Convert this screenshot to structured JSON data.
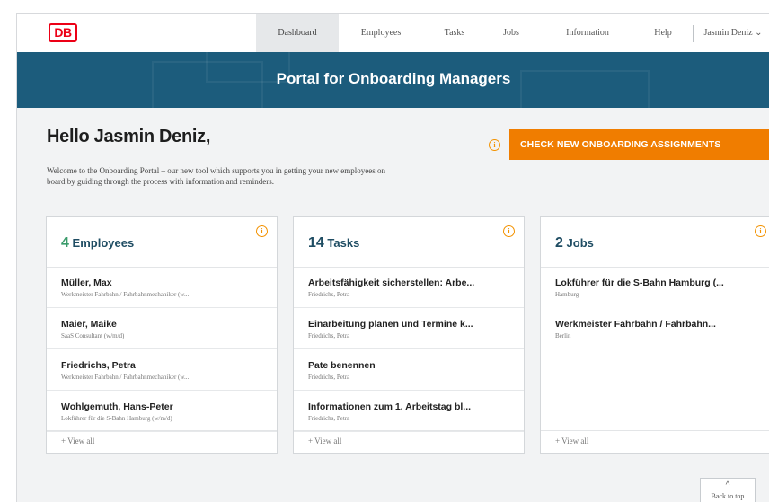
{
  "nav": {
    "logo": "DB",
    "items": [
      "Dashboard",
      "Employees",
      "Tasks",
      "Jobs",
      "Information",
      "Help"
    ],
    "user": "Jasmin Deniz ⌄"
  },
  "banner": {
    "title": "Portal for Onboarding Managers"
  },
  "greeting": "Hello Jasmin Deniz,",
  "intro": "Welcome to the Onboarding Portal – our new tool which supports you in getting your new employees on board by guiding through the process with information and reminders.",
  "cta": {
    "info": "i",
    "label": "CHECK NEW ONBOARDING ASSIGNMENTS"
  },
  "cards": [
    {
      "count": "4",
      "label": "Employees",
      "rows": [
        {
          "title": "Müller, Max",
          "sub": "Werkmeister Fahrbahn / Fahrbahnmechaniker (w..."
        },
        {
          "title": "Maier, Maike",
          "sub": "SaaS Consultant (w/m/d)"
        },
        {
          "title": "Friedrichs, Petra",
          "sub": "Werkmeister Fahrbahn / Fahrbahnmechaniker (w..."
        },
        {
          "title": "Wohlgemuth, Hans-Peter",
          "sub": "Lokführer für die S-Bahn Hamburg (w/m/d)"
        }
      ],
      "view_all": "+ View all"
    },
    {
      "count": "14",
      "label": "Tasks",
      "rows": [
        {
          "title": "Arbeitsfähigkeit sicherstellen: Arbe...",
          "sub": "Friedrichs, Petra"
        },
        {
          "title": "Einarbeitung planen und Termine k...",
          "sub": "Friedrichs, Petra"
        },
        {
          "title": "Pate benennen",
          "sub": "Friedrichs, Petra"
        },
        {
          "title": "Informationen zum 1. Arbeitstag bl...",
          "sub": "Friedrichs, Petra"
        }
      ],
      "view_all": "+ View all"
    },
    {
      "count": "2",
      "label": "Jobs",
      "rows": [
        {
          "title": "Lokführer für die S-Bahn Hamburg (...",
          "sub": "Hamburg"
        },
        {
          "title": "Werkmeister Fahrbahn / Fahrbahn...",
          "sub": "Berlin"
        }
      ],
      "view_all": "+ View all"
    }
  ],
  "back_to_top": {
    "icon": "^",
    "label": "Back to top"
  },
  "colors": {
    "brand_red": "#ec0016",
    "banner": "#1c5c7c",
    "cta": "#f07d00",
    "accent_green": "#3a9b6b"
  },
  "icons": [
    "db-logo",
    "info-icon",
    "chevron-up-icon"
  ]
}
